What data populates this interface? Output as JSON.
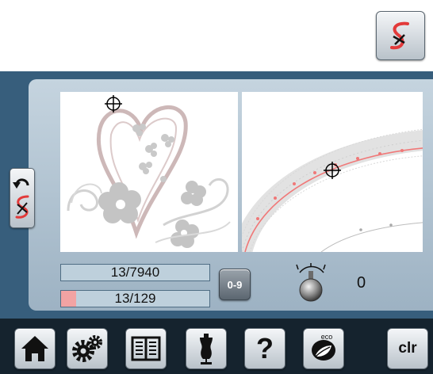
{
  "counters": {
    "stitch_total": "13/7940",
    "color_stitch": "13/129",
    "color_progress": 0.1
  },
  "controls": {
    "numpad_label": "0-9",
    "speed_value": "0",
    "eco_label": "eco",
    "clear_label": "clr",
    "help_label": "?"
  },
  "icons": {
    "top_button": "sew-path-icon",
    "side_button": "return-sew-path-icon",
    "home": "home-icon",
    "settings": "gears-icon",
    "tutorial": "book-icon",
    "dress": "dress-form-icon",
    "eco": "eco-leaf-icon",
    "knob": "speed-knob-icon"
  },
  "colors": {
    "panel_dark": "#375e7c",
    "panel_light": "#c5d4df",
    "bar": "#15232e",
    "accent_red": "#e23a3a",
    "progress": "#f2a3a3"
  }
}
